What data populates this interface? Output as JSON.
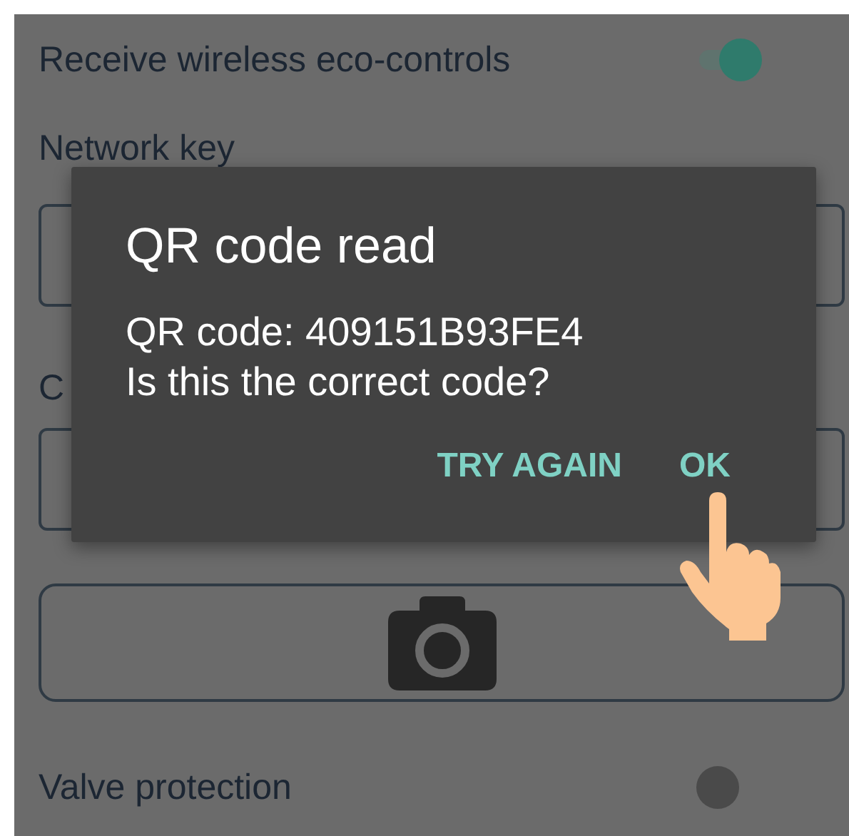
{
  "settings": [
    {
      "kind": "toggle",
      "label": "Receive wireless eco-controls",
      "on": true
    },
    {
      "kind": "field",
      "label": "Network key"
    },
    {
      "kind": "field",
      "label": "C"
    },
    {
      "kind": "camera"
    },
    {
      "kind": "toggle",
      "label": "Valve protection",
      "on": false
    }
  ],
  "dialog": {
    "title": "QR code read",
    "message": [
      "QR code: 409151B93FE4",
      "Is this the correct code?"
    ],
    "buttons": [
      "TRY AGAIN",
      "OK"
    ]
  }
}
